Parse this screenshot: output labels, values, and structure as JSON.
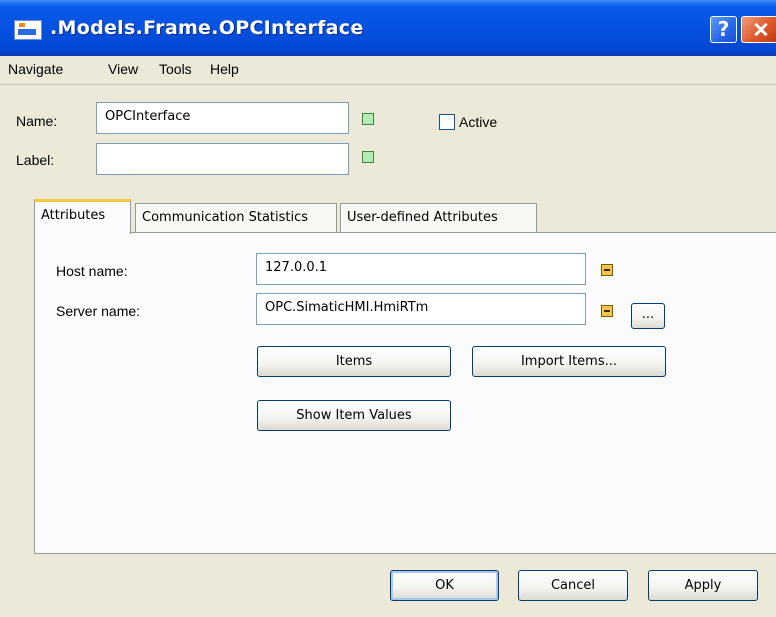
{
  "window": {
    "title": ".Models.Frame.OPCInterface",
    "help_label": "?"
  },
  "menu": {
    "items": [
      "Navigate",
      "View",
      "Tools",
      "Help"
    ]
  },
  "form": {
    "name_label": "Name:",
    "name_value": "OPCInterface",
    "label_label": "Label:",
    "label_value": "",
    "active_label": "Active",
    "active_checked": false
  },
  "tabs": [
    {
      "label": "Attributes",
      "active": true
    },
    {
      "label": "Communication Statistics",
      "active": false
    },
    {
      "label": "User-defined Attributes",
      "active": false
    }
  ],
  "attributes": {
    "host_label": "Host name:",
    "host_value": "127.0.0.1",
    "server_label": "Server name:",
    "server_value": "OPC.SimaticHMI.HmiRTm",
    "browse_label": "...",
    "items_button": "Items",
    "import_button": "Import Items...",
    "show_values_button": "Show Item Values"
  },
  "footer": {
    "ok": "OK",
    "cancel": "Cancel",
    "apply": "Apply"
  },
  "colors": {
    "titlebar": "#0551e0",
    "dialog_bg": "#ece9d8",
    "tab_highlight": "#ffc83c",
    "status_green": "#b7eab9",
    "status_orange": "#f5c44a"
  }
}
